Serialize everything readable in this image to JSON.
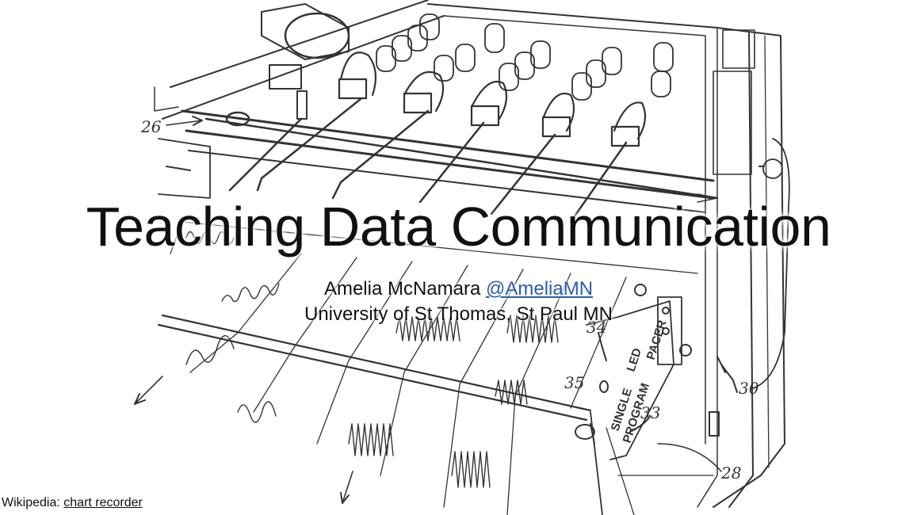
{
  "slide": {
    "title": "Teaching Data Communication",
    "author_name": "Amelia McNamara",
    "author_handle": "@AmeliaMN",
    "affiliation": "University of St Thomas, St Paul MN",
    "credit_prefix": "Wikipedia:",
    "credit_link": "chart recorder"
  },
  "figure_labels": {
    "l26": "26",
    "l34": "34",
    "l35": "35",
    "l30": "30",
    "l33": "33",
    "l28": "28",
    "led": "LED",
    "pacer": "PACER",
    "single": "SINGLE",
    "program": "PROGRAM"
  },
  "colors": {
    "text": "#111111",
    "link": "#2a5db0",
    "drawing": "#333333"
  }
}
